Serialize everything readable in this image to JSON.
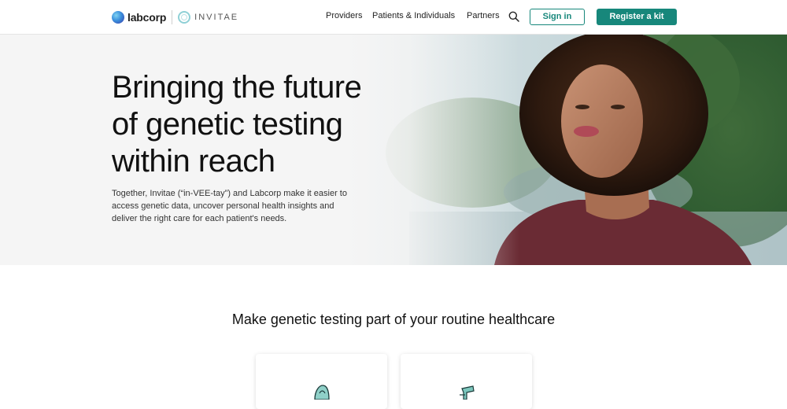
{
  "header": {
    "brand_primary": "labcorp",
    "brand_secondary": "INVITAE",
    "nav": [
      "Providers",
      "Patients & Individuals",
      "Partners"
    ],
    "sign_in_label": "Sign in",
    "register_label": "Register a kit",
    "search_icon": "search-icon"
  },
  "hero": {
    "title": "Bringing the future of genetic testing within reach",
    "description": "Together, Invitae (“in-VEE-tay”) and Labcorp make it easier to access genetic data, uncover personal health insights and deliver the right care for each patient's needs."
  },
  "section": {
    "title": "Make genetic testing part of your routine healthcare"
  },
  "colors": {
    "accent": "#17877b",
    "text": "#111111",
    "labcorp_logo": "#3a8fdc",
    "invitae_logo": "#8fd0d6"
  }
}
